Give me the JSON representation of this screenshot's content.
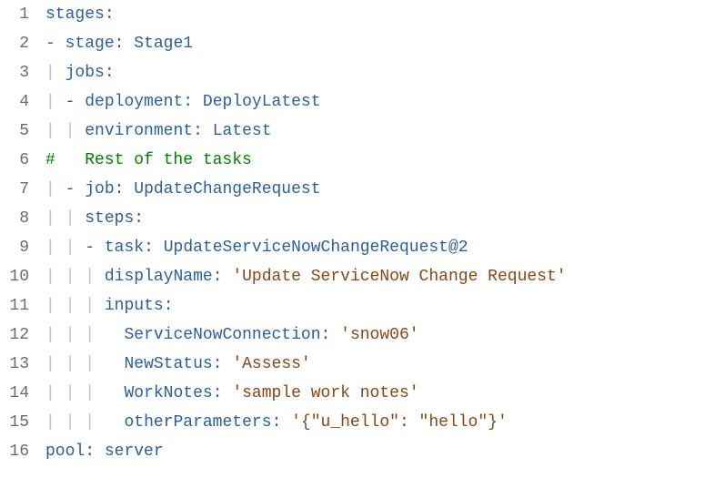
{
  "code_lines": [
    {
      "num": "1",
      "html": "<span class='key'>stages</span><span class='colon'>:</span>"
    },
    {
      "num": "2",
      "html": "<span class='dash'>-</span> <span class='key'>stage</span><span class='colon'>:</span> <span class='value-bare'>Stage1</span>"
    },
    {
      "num": "3",
      "html": "<span class='pipe'>|</span> <span class='key'>jobs</span><span class='colon'>:</span>"
    },
    {
      "num": "4",
      "html": "<span class='pipe'>|</span> <span class='dash'>-</span> <span class='key'>deployment</span><span class='colon'>:</span> <span class='value-bare'>DeployLatest</span>"
    },
    {
      "num": "5",
      "html": "<span class='pipe'>|</span> <span class='pipe'>|</span> <span class='key'>environment</span><span class='colon'>:</span> <span class='value-bare'>Latest</span>"
    },
    {
      "num": "6",
      "html": "<span class='comment'>#   Rest of the tasks</span>"
    },
    {
      "num": "7",
      "html": "<span class='pipe'>|</span> <span class='dash'>-</span> <span class='key'>job</span><span class='colon'>:</span> <span class='value-bare'>UpdateChangeRequest</span>"
    },
    {
      "num": "8",
      "html": "<span class='pipe'>|</span> <span class='pipe'>|</span> <span class='key'>steps</span><span class='colon'>:</span>"
    },
    {
      "num": "9",
      "html": "<span class='pipe'>|</span> <span class='pipe'>|</span> <span class='dash'>-</span> <span class='key'>task</span><span class='colon'>:</span> <span class='value-bare'>UpdateServiceNowChangeRequest@2</span>"
    },
    {
      "num": "10",
      "html": "<span class='pipe'>|</span> <span class='pipe'>|</span> <span class='pipe'>|</span> <span class='key'>displayName</span><span class='colon'>:</span> <span class='string'>'Update ServiceNow Change Request'</span>"
    },
    {
      "num": "11",
      "html": "<span class='pipe'>|</span> <span class='pipe'>|</span> <span class='pipe'>|</span> <span class='key'>inputs</span><span class='colon'>:</span>"
    },
    {
      "num": "12",
      "html": "<span class='pipe'>|</span> <span class='pipe'>|</span> <span class='pipe'>|</span>   <span class='key'>ServiceNowConnection</span><span class='colon'>:</span> <span class='string'>'snow06'</span>"
    },
    {
      "num": "13",
      "html": "<span class='pipe'>|</span> <span class='pipe'>|</span> <span class='pipe'>|</span>   <span class='key'>NewStatus</span><span class='colon'>:</span> <span class='string'>'Assess'</span>"
    },
    {
      "num": "14",
      "html": "<span class='pipe'>|</span> <span class='pipe'>|</span> <span class='pipe'>|</span>   <span class='key'>WorkNotes</span><span class='colon'>:</span> <span class='string'>'sample work notes'</span>"
    },
    {
      "num": "15",
      "html": "<span class='pipe'>|</span> <span class='pipe'>|</span> <span class='pipe'>|</span>   <span class='key'>otherParameters</span><span class='colon'>:</span> <span class='string'>'{\"u_hello\": \"hello\"}'</span>"
    },
    {
      "num": "16",
      "html": "<span class='key'>pool</span><span class='colon'>:</span> <span class='value-bare'>server</span>"
    }
  ]
}
